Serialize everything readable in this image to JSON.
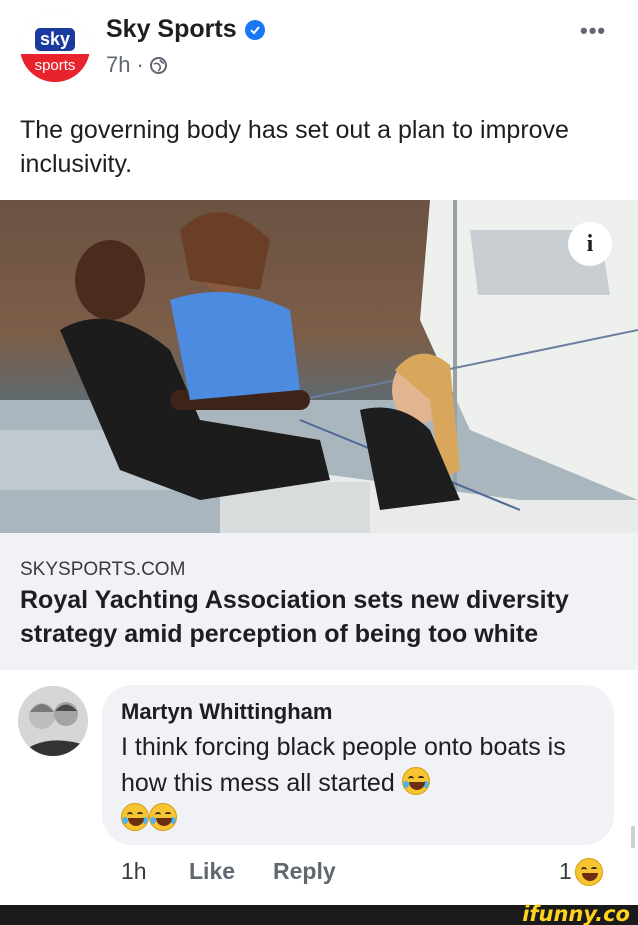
{
  "post": {
    "page_name": "Sky Sports",
    "time": "7h",
    "separator": "·",
    "avatar_top": "sky",
    "avatar_bottom": "sports",
    "more_label": "•••",
    "caption": "The governing body has set out a plan to improve inclusivity."
  },
  "link": {
    "domain": "SKYSPORTS.COM",
    "headline": "Royal Yachting Association sets new diversity strategy amid perception of being too white"
  },
  "comment": {
    "author": "Martyn Whittingham",
    "text": "I think forcing black people onto boats is how this mess all started",
    "time": "1h",
    "like_label": "Like",
    "reply_label": "Reply",
    "reaction_count": "1"
  },
  "watermark": "ifunny.co",
  "colors": {
    "brand_blue": "#1877f2",
    "sky_red": "#e8232d",
    "sky_blue": "#1a3a9e",
    "link_bg": "#f0f2f5",
    "ifunny_yellow": "#ffd21f"
  }
}
